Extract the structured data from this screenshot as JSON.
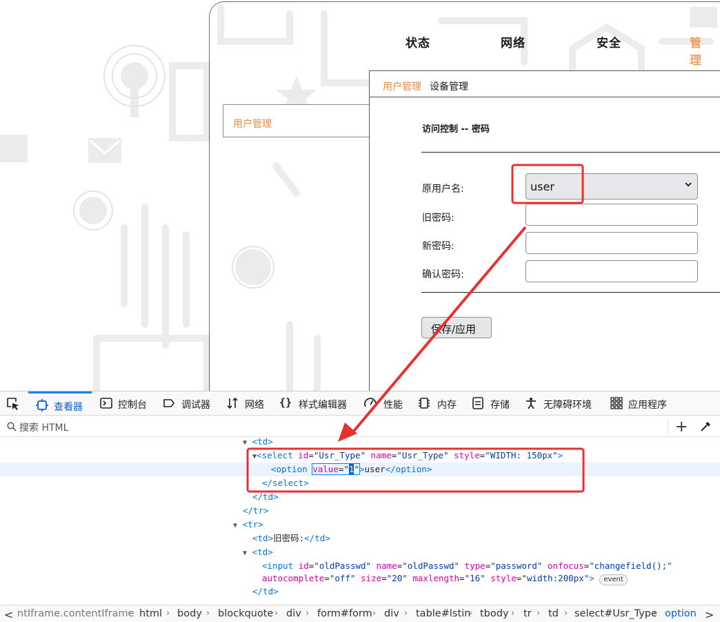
{
  "router": {
    "nav": [
      "状态",
      "网络",
      "安全",
      "管 理"
    ],
    "sidebar_item": "用户管理",
    "subtabs": [
      "用户管理",
      "设备管理"
    ],
    "section_title": "访问控制 -- 密码",
    "fields": {
      "username_label": "原用户名:",
      "username_value": "user",
      "old_password_label": "旧密码:",
      "new_password_label": "新密码:",
      "confirm_password_label": "确认密码:"
    },
    "save_button": "保存/应用"
  },
  "devtools": {
    "tabs": [
      "查看器",
      "控制台",
      "调试器",
      "网络",
      "样式编辑器",
      "性能",
      "内存",
      "存储",
      "无障碍环境",
      "应用程序"
    ],
    "active_tab": "查看器",
    "search_placeholder": "搜索 HTML",
    "event_badge": "event",
    "code": {
      "td_open": "<td>",
      "select_tag": "select",
      "select_id": "Usr_Type",
      "select_name": "Usr_Type",
      "select_style": "WIDTH: 150px",
      "option_value": "1",
      "option_text": "user",
      "old_password_label_cell": "旧密码:",
      "input_id": "oldPasswd",
      "input_name": "oldPasswd",
      "input_type": "password",
      "input_onfocus": "changefield();",
      "input_autocomplete": "off",
      "input_size": "20",
      "input_maxlength": "16",
      "input_style": "width:200px"
    },
    "breadcrumbs": [
      "ntIframe.contentIframe",
      "html",
      "body",
      "blockquote",
      "div",
      "form#form",
      "div",
      "table#lstin",
      "tbody",
      "tr",
      "td",
      "select#Usr_Type",
      "option"
    ]
  },
  "colors": {
    "accent_orange": "#ef8a3c",
    "annotation_red": "#e8312f",
    "devtools_blue": "#0a84ff"
  }
}
